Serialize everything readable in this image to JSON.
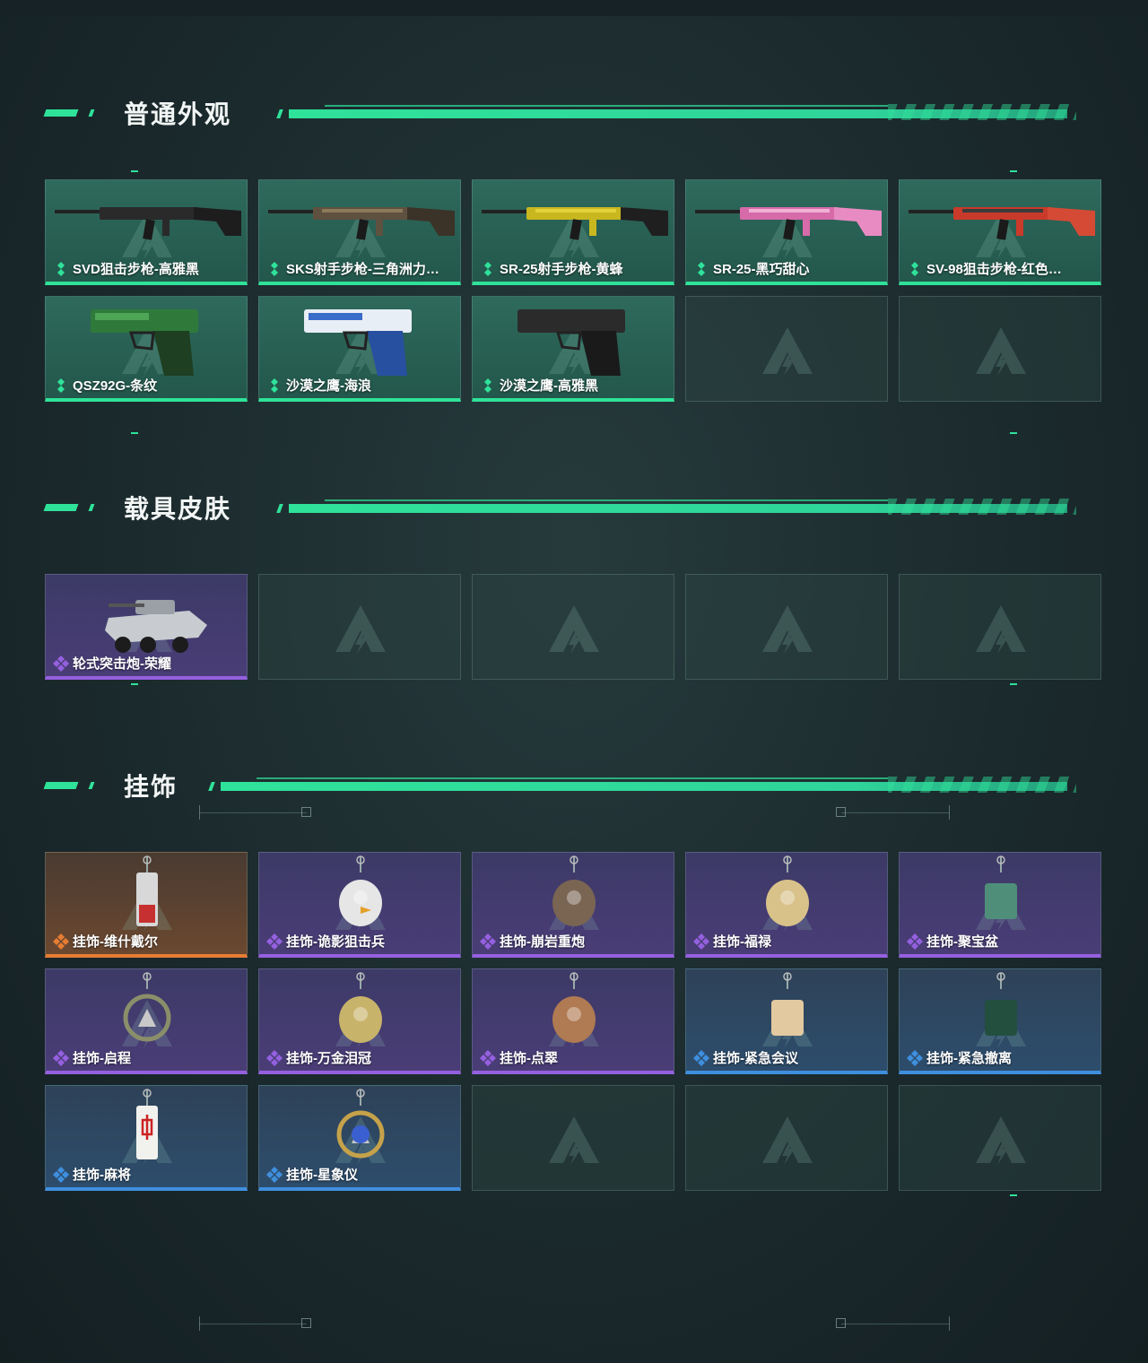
{
  "sections": [
    {
      "title": "普通外观",
      "items": [
        {
          "label": "SVD狙击步枪-高雅黑",
          "rarity": "green",
          "icon": "sniper-rifle-black"
        },
        {
          "label": "SKS射手步枪-三角洲力…",
          "rarity": "green",
          "icon": "rifle-camo"
        },
        {
          "label": "SR-25射手步枪-黄蜂",
          "rarity": "green",
          "icon": "rifle-yellow-black"
        },
        {
          "label": "SR-25-黑巧甜心",
          "rarity": "green",
          "icon": "rifle-pink"
        },
        {
          "label": "SV-98狙击步枪-红色…",
          "rarity": "green",
          "icon": "sniper-rifle-red"
        },
        {
          "label": "QSZ92G-条纹",
          "rarity": "green",
          "icon": "pistol-green"
        },
        {
          "label": "沙漠之鹰-海浪",
          "rarity": "green",
          "icon": "pistol-blue"
        },
        {
          "label": "沙漠之鹰-高雅黑",
          "rarity": "green",
          "icon": "pistol-black"
        }
      ],
      "empty_slots": 2
    },
    {
      "title": "载具皮肤",
      "items": [
        {
          "label": "轮式突击炮-荣耀",
          "rarity": "purple",
          "icon": "armored-vehicle"
        }
      ],
      "empty_slots": 4
    },
    {
      "title": "挂饰",
      "items": [
        {
          "label": "挂饰-维什戴尔",
          "rarity": "orange",
          "icon": "charm-capsule"
        },
        {
          "label": "挂饰-诡影狙击兵",
          "rarity": "purple",
          "icon": "charm-bird"
        },
        {
          "label": "挂饰-崩岩重炮",
          "rarity": "purple",
          "icon": "charm-figure"
        },
        {
          "label": "挂饰-福禄",
          "rarity": "purple",
          "icon": "charm-gourd"
        },
        {
          "label": "挂饰-聚宝盆",
          "rarity": "purple",
          "icon": "charm-bowl"
        },
        {
          "label": "挂饰-启程",
          "rarity": "purple",
          "icon": "charm-ring"
        },
        {
          "label": "挂饰-万金泪冠",
          "rarity": "purple",
          "icon": "charm-crown"
        },
        {
          "label": "挂饰-点翠",
          "rarity": "purple",
          "icon": "charm-feather"
        },
        {
          "label": "挂饰-紧急会议",
          "rarity": "blue",
          "icon": "charm-badge"
        },
        {
          "label": "挂饰-紧急撤离",
          "rarity": "blue",
          "icon": "charm-tag"
        },
        {
          "label": "挂饰-麻将",
          "rarity": "blue",
          "icon": "charm-mahjong"
        },
        {
          "label": "挂饰-星象仪",
          "rarity": "blue",
          "icon": "charm-astrolabe"
        }
      ],
      "empty_slots": 3
    }
  ],
  "colors": {
    "accent": "#2fe29a",
    "green": "#2fe29a",
    "purple": "#9560e0",
    "orange": "#e77d33",
    "blue": "#3f8fdf"
  }
}
